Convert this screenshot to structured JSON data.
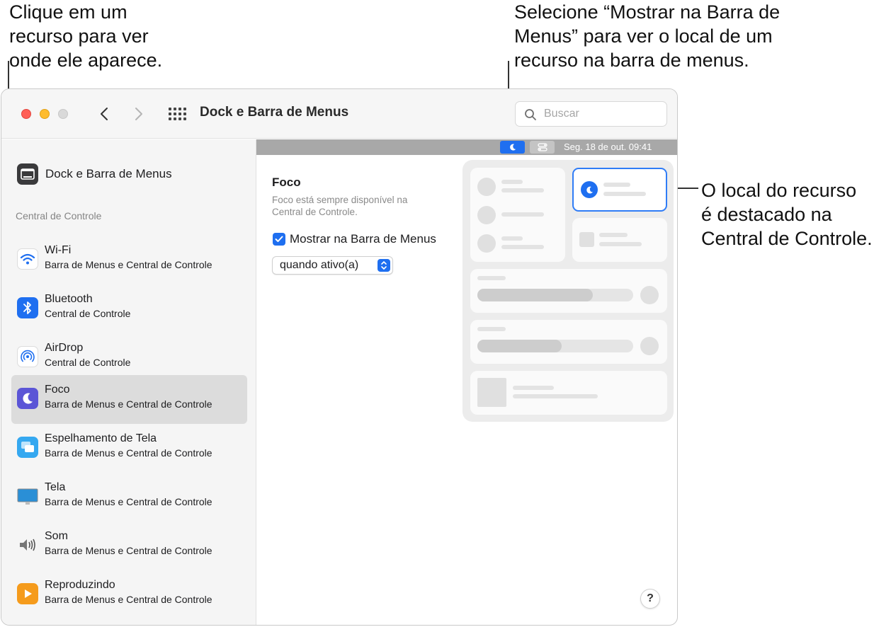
{
  "callouts": {
    "left": [
      "Clique em um",
      "recurso para ver",
      "onde ele aparece."
    ],
    "top": [
      "Selecione “Mostrar na Barra de",
      "Menus” para ver o local de um",
      "recurso na barra de menus."
    ],
    "right": [
      "O local do recurso",
      "é destacado na",
      "Central de Controle."
    ]
  },
  "window": {
    "title": "Dock e Barra de Menus",
    "search_placeholder": "Buscar"
  },
  "sidebar": {
    "top_item": "Dock e Barra de Menus",
    "section_header": "Central de Controle",
    "items": [
      {
        "name": "Wi-Fi",
        "sub": "Barra de Menus e Central de Controle",
        "icon": "wifi-icon"
      },
      {
        "name": "Bluetooth",
        "sub": "Central de Controle",
        "icon": "bluetooth-icon"
      },
      {
        "name": "AirDrop",
        "sub": "Central de Controle",
        "icon": "airdrop-icon"
      },
      {
        "name": "Foco",
        "sub": "Barra de Menus e Central de Controle",
        "icon": "moon-icon",
        "selected": true
      },
      {
        "name": "Espelhamento de Tela",
        "sub": "Barra de Menus e Central de Controle",
        "icon": "screen-mirroring-icon"
      },
      {
        "name": "Tela",
        "sub": "Barra de Menus e Central de Controle",
        "icon": "display-icon"
      },
      {
        "name": "Som",
        "sub": "Barra de Menus e Central de Controle",
        "icon": "speaker-icon"
      },
      {
        "name": "Reproduzindo",
        "sub": "Barra de Menus e Central de Controle",
        "icon": "play-icon"
      }
    ]
  },
  "menubar": {
    "datetime": "Seg. 18 de out.  09:41"
  },
  "content": {
    "title": "Foco",
    "description": "Foco está sempre disponível na Central de Controle.",
    "checkbox_label": "Mostrar na Barra de Menus",
    "checkbox_checked": true,
    "select_value": "quando ativo(a)"
  },
  "colors": {
    "accent": "#1f6ff0",
    "highlight": "#2f7cf6",
    "focus_icon": "#5b55d6"
  },
  "help_label": "?"
}
